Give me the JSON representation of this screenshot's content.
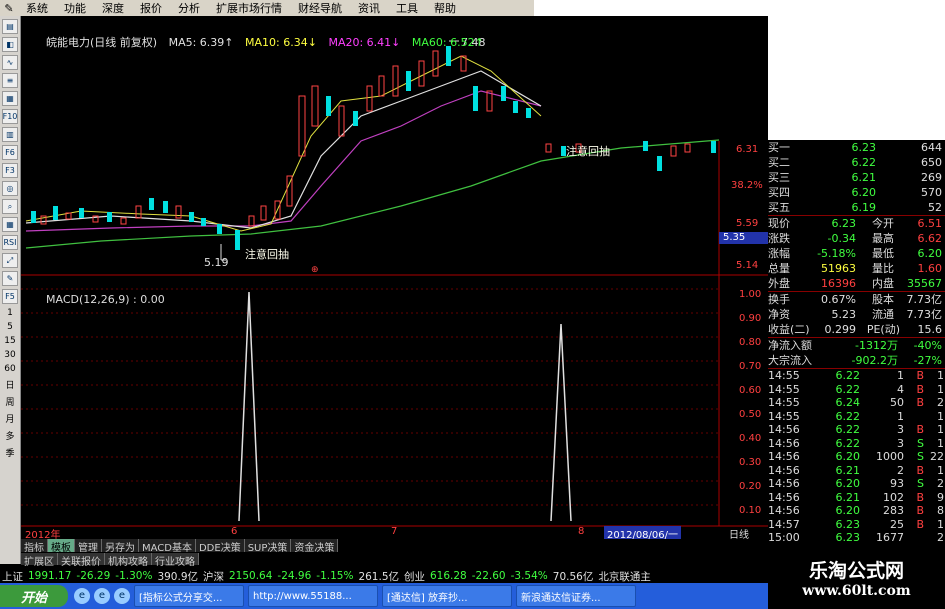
{
  "menu": [
    "系统",
    "功能",
    "深度",
    "报价",
    "分析",
    "扩展市场行情",
    "财经导航",
    "资讯",
    "工具",
    "帮助"
  ],
  "chart_header": {
    "stock": "皖能电力(日线 前复权)",
    "ma5": "MA5: 6.39↑",
    "ma10": "MA10: 6.34↓",
    "ma20": "MA20: 6.41↓",
    "ma60": "MA60: 6.52↑"
  },
  "annotations": {
    "high": "7.48",
    "low": "5.19",
    "note1": "注意回抽",
    "note2": "注意回抽"
  },
  "price_axis": [
    "6.31",
    "38.2%",
    "5.59",
    "5.35",
    "5.14"
  ],
  "macd": {
    "title": "MACD(12,26,9) : 0.00",
    "axis": [
      "1.00",
      "0.90",
      "0.80",
      "0.70",
      "0.60",
      "0.50",
      "0.40",
      "0.30",
      "0.20",
      "0.10"
    ]
  },
  "timeline": {
    "y2012": "2012年",
    "m6": "6",
    "m7": "7",
    "m8": "8",
    "date": "2012/08/06/一",
    "period": "日线"
  },
  "left_toolbar_numbers": [
    "1",
    "5",
    "15",
    "30",
    "60",
    "日",
    "周",
    "月",
    "多",
    "季"
  ],
  "quote": {
    "bids": [
      {
        "label": "买一",
        "price": "6.23",
        "vol": "644"
      },
      {
        "label": "买二",
        "price": "6.22",
        "vol": "650"
      },
      {
        "label": "买三",
        "price": "6.21",
        "vol": "269"
      },
      {
        "label": "买四",
        "price": "6.20",
        "vol": "570"
      },
      {
        "label": "买五",
        "price": "6.19",
        "vol": "52"
      }
    ],
    "stats": [
      {
        "l1": "现价",
        "v1": "6.23",
        "l2": "今开",
        "v2": "6.51"
      },
      {
        "l1": "涨跌",
        "v1": "-0.34",
        "l2": "最高",
        "v2": "6.62"
      },
      {
        "l1": "涨幅",
        "v1": "-5.18%",
        "l2": "最低",
        "v2": "6.20"
      },
      {
        "l1": "总量",
        "v1": "51963",
        "l2": "量比",
        "v2": "1.60"
      },
      {
        "l1": "外盘",
        "v1": "16396",
        "l2": "内盘",
        "v2": "35567"
      }
    ],
    "stats2": [
      {
        "l1": "换手",
        "v1": "0.67%",
        "l2": "股本",
        "v2": "7.73亿"
      },
      {
        "l1": "净资",
        "v1": "5.23",
        "l2": "流通",
        "v2": "7.73亿"
      },
      {
        "l1": "收益(二)",
        "v1": "0.299",
        "l2": "PE(动)",
        "v2": "15.6"
      }
    ],
    "flow": [
      {
        "l": "净流入额",
        "v": "-1312万",
        "p": "-40%"
      },
      {
        "l": "大宗流入",
        "v": "-902.2万",
        "p": "-27%"
      }
    ],
    "ticks": [
      {
        "t": "14:55",
        "p": "6.22",
        "v": "1",
        "f": "B",
        "n": "1"
      },
      {
        "t": "14:55",
        "p": "6.22",
        "v": "4",
        "f": "B",
        "n": "1"
      },
      {
        "t": "14:55",
        "p": "6.24",
        "v": "50",
        "f": "B",
        "n": "2"
      },
      {
        "t": "14:55",
        "p": "6.22",
        "v": "1",
        "f": "",
        "n": "1"
      },
      {
        "t": "14:56",
        "p": "6.22",
        "v": "3",
        "f": "B",
        "n": "1"
      },
      {
        "t": "14:56",
        "p": "6.22",
        "v": "3",
        "f": "S",
        "n": "1"
      },
      {
        "t": "14:56",
        "p": "6.20",
        "v": "1000",
        "f": "S",
        "n": "22"
      },
      {
        "t": "14:56",
        "p": "6.21",
        "v": "2",
        "f": "B",
        "n": "1"
      },
      {
        "t": "14:56",
        "p": "6.20",
        "v": "93",
        "f": "S",
        "n": "2"
      },
      {
        "t": "14:56",
        "p": "6.21",
        "v": "102",
        "f": "B",
        "n": "9"
      },
      {
        "t": "14:56",
        "p": "6.20",
        "v": "283",
        "f": "B",
        "n": "8"
      },
      {
        "t": "14:57",
        "p": "6.23",
        "v": "25",
        "f": "B",
        "n": "1"
      },
      {
        "t": "15:00",
        "p": "6.23",
        "v": "1677",
        "f": "",
        "n": "2"
      }
    ]
  },
  "tabs": [
    "指标",
    "模板",
    "管理",
    "另存为",
    "MACD基本",
    "DDE决策",
    "SUP决策",
    "资金决策"
  ],
  "tabs2": [
    "扩展区",
    "关联报价",
    "机构攻略",
    "行业攻略"
  ],
  "ticker": {
    "sh_label": "上证",
    "sh": "1991.17",
    "sh_chg": "-26.29",
    "sh_pct": "-1.30%",
    "sh_amt": "390.9亿",
    "sz_label": "沪深",
    "sz": "2150.64",
    "sz_chg": "-24.96",
    "sz_pct": "-1.15%",
    "sz_amt": "261.5亿",
    "cy_label": "创业",
    "cy": "616.28",
    "cy_chg": "-22.60",
    "cy_pct": "-3.54%",
    "cy_amt": "70.56亿",
    "broker": "北京联通主"
  },
  "taskbar": {
    "start": "开始",
    "tasks": [
      "[指标公式分享交...",
      "http://www.55188...",
      "[通达信] 放弃抄...",
      "新浪通达信证券..."
    ]
  },
  "watermark": {
    "line1": "乐淘公式网",
    "line2": "www.60lt.com"
  },
  "chart_data": {
    "type": "candlestick",
    "title": "皖能电力(日线 前复权)",
    "y_range": [
      5.14,
      7.55
    ],
    "labeled_points": {
      "high": 7.48,
      "low": 5.19
    },
    "last_price": 6.23,
    "macd_axis_range": [
      0.0,
      1.0
    ],
    "macd_spikes": [
      {
        "position": "June 2012",
        "value": 1.0
      },
      {
        "position": "August 2012",
        "value": 0.85
      }
    ]
  }
}
